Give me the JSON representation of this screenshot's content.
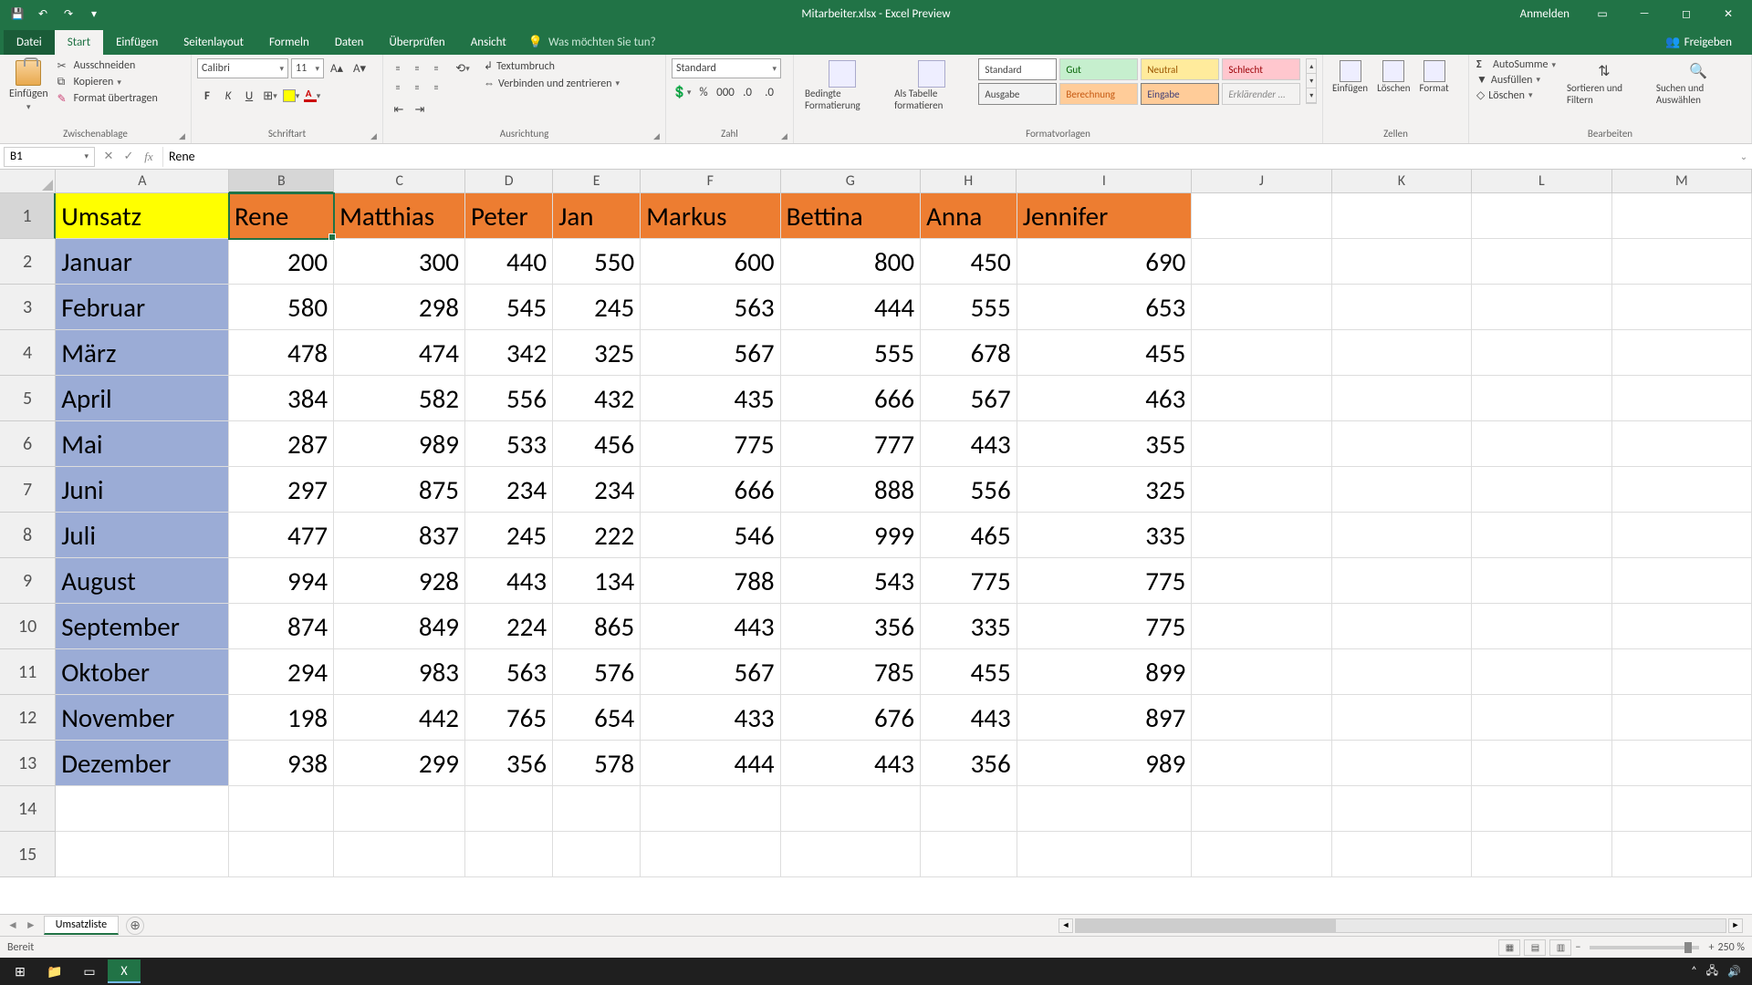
{
  "title": "Mitarbeiter.xlsx - Excel Preview",
  "titlebar": {
    "login": "Anmelden"
  },
  "tabs": {
    "file": "Datei",
    "start": "Start",
    "einfuegen": "Einfügen",
    "layout": "Seitenlayout",
    "formeln": "Formeln",
    "daten": "Daten",
    "ueberpruefen": "Überprüfen",
    "ansicht": "Ansicht",
    "tellme_placeholder": "Was möchten Sie tun?",
    "share": "Freigeben"
  },
  "ribbon": {
    "clipboard": {
      "paste": "Einfügen",
      "cut": "Ausschneiden",
      "copy": "Kopieren",
      "brush": "Format übertragen",
      "group": "Zwischenablage"
    },
    "font": {
      "name": "Calibri",
      "size": "11",
      "group": "Schriftart"
    },
    "align": {
      "wrap": "Textumbruch",
      "merge": "Verbinden und zentrieren",
      "group": "Ausrichtung"
    },
    "number": {
      "format": "Standard",
      "group": "Zahl"
    },
    "styles": {
      "cond": "Bedingte Formatierung",
      "astable": "Als Tabelle formatieren",
      "standard": "Standard",
      "gut": "Gut",
      "neutral": "Neutral",
      "schlecht": "Schlecht",
      "ausgabe": "Ausgabe",
      "berechnung": "Berechnung",
      "eingabe": "Eingabe",
      "erklaerender": "Erklärender ...",
      "group": "Formatvorlagen"
    },
    "cells": {
      "insert": "Einfügen",
      "delete": "Löschen",
      "format": "Format",
      "group": "Zellen"
    },
    "edit": {
      "autosum": "AutoSumme",
      "fill": "Ausfüllen",
      "clear": "Löschen",
      "sort": "Sortieren und Filtern",
      "find": "Suchen und Auswählen",
      "group": "Bearbeiten"
    }
  },
  "namebox": "B1",
  "formula": "Rene",
  "columns": [
    "A",
    "B",
    "C",
    "D",
    "E",
    "F",
    "G",
    "H",
    "I",
    "J",
    "K",
    "L",
    "M"
  ],
  "data": {
    "a1": "Umsatz",
    "headers": [
      "Rene",
      "Matthias",
      "Peter",
      "Jan",
      "Markus",
      "Bettina",
      "Anna",
      "Jennifer"
    ],
    "rows": [
      {
        "month": "Januar",
        "vals": [
          200,
          300,
          440,
          550,
          600,
          800,
          450,
          690
        ]
      },
      {
        "month": "Februar",
        "vals": [
          580,
          298,
          545,
          245,
          563,
          444,
          555,
          653
        ]
      },
      {
        "month": "März",
        "vals": [
          478,
          474,
          342,
          325,
          567,
          555,
          678,
          455
        ]
      },
      {
        "month": "April",
        "vals": [
          384,
          582,
          556,
          432,
          435,
          666,
          567,
          463
        ]
      },
      {
        "month": "Mai",
        "vals": [
          287,
          989,
          533,
          456,
          775,
          777,
          443,
          355
        ]
      },
      {
        "month": "Juni",
        "vals": [
          297,
          875,
          234,
          234,
          666,
          888,
          556,
          325
        ]
      },
      {
        "month": "Juli",
        "vals": [
          477,
          837,
          245,
          222,
          546,
          999,
          465,
          335
        ]
      },
      {
        "month": "August",
        "vals": [
          994,
          928,
          443,
          134,
          788,
          543,
          775,
          775
        ]
      },
      {
        "month": "September",
        "vals": [
          874,
          849,
          224,
          865,
          443,
          356,
          335,
          775
        ]
      },
      {
        "month": "Oktober",
        "vals": [
          294,
          983,
          563,
          576,
          567,
          785,
          455,
          899
        ]
      },
      {
        "month": "November",
        "vals": [
          198,
          442,
          765,
          654,
          433,
          676,
          443,
          897
        ]
      },
      {
        "month": "Dezember",
        "vals": [
          938,
          299,
          356,
          578,
          444,
          443,
          356,
          989
        ]
      }
    ]
  },
  "sheet_tab": "Umsatzliste",
  "status": {
    "ready": "Bereit",
    "zoom": "250 %"
  }
}
